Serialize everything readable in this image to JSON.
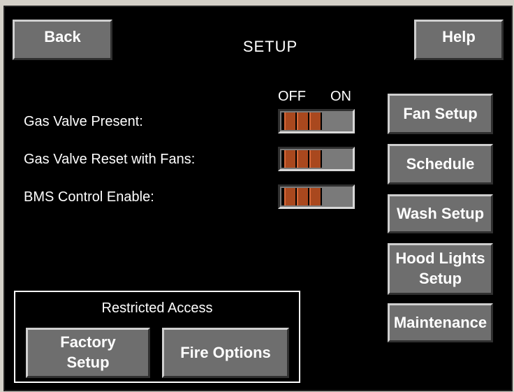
{
  "header": {
    "title": "SETUP",
    "back_label": "Back",
    "help_label": "Help"
  },
  "toggle_scale": {
    "off_label": "OFF",
    "on_label": "ON"
  },
  "settings": [
    {
      "label": "Gas Valve Present:",
      "state": "OFF"
    },
    {
      "label": "Gas Valve Reset with Fans:",
      "state": "OFF"
    },
    {
      "label": "BMS Control Enable:",
      "state": "OFF"
    }
  ],
  "side_menu": [
    {
      "line1": "Fan Setup",
      "line2": ""
    },
    {
      "line1": "Schedule",
      "line2": ""
    },
    {
      "line1": "Wash Setup",
      "line2": ""
    },
    {
      "line1": "Hood Lights",
      "line2": "Setup"
    },
    {
      "line1": "Maintenance",
      "line2": ""
    }
  ],
  "restricted": {
    "title": "Restricted Access",
    "factory_setup": {
      "line1": "Factory",
      "line2": "Setup"
    },
    "fire_options": "Fire Options"
  },
  "colors": {
    "background": "#000000",
    "button_face": "#6e6e6e",
    "toggle_thumb": "#a9481e",
    "text": "#ffffff"
  }
}
